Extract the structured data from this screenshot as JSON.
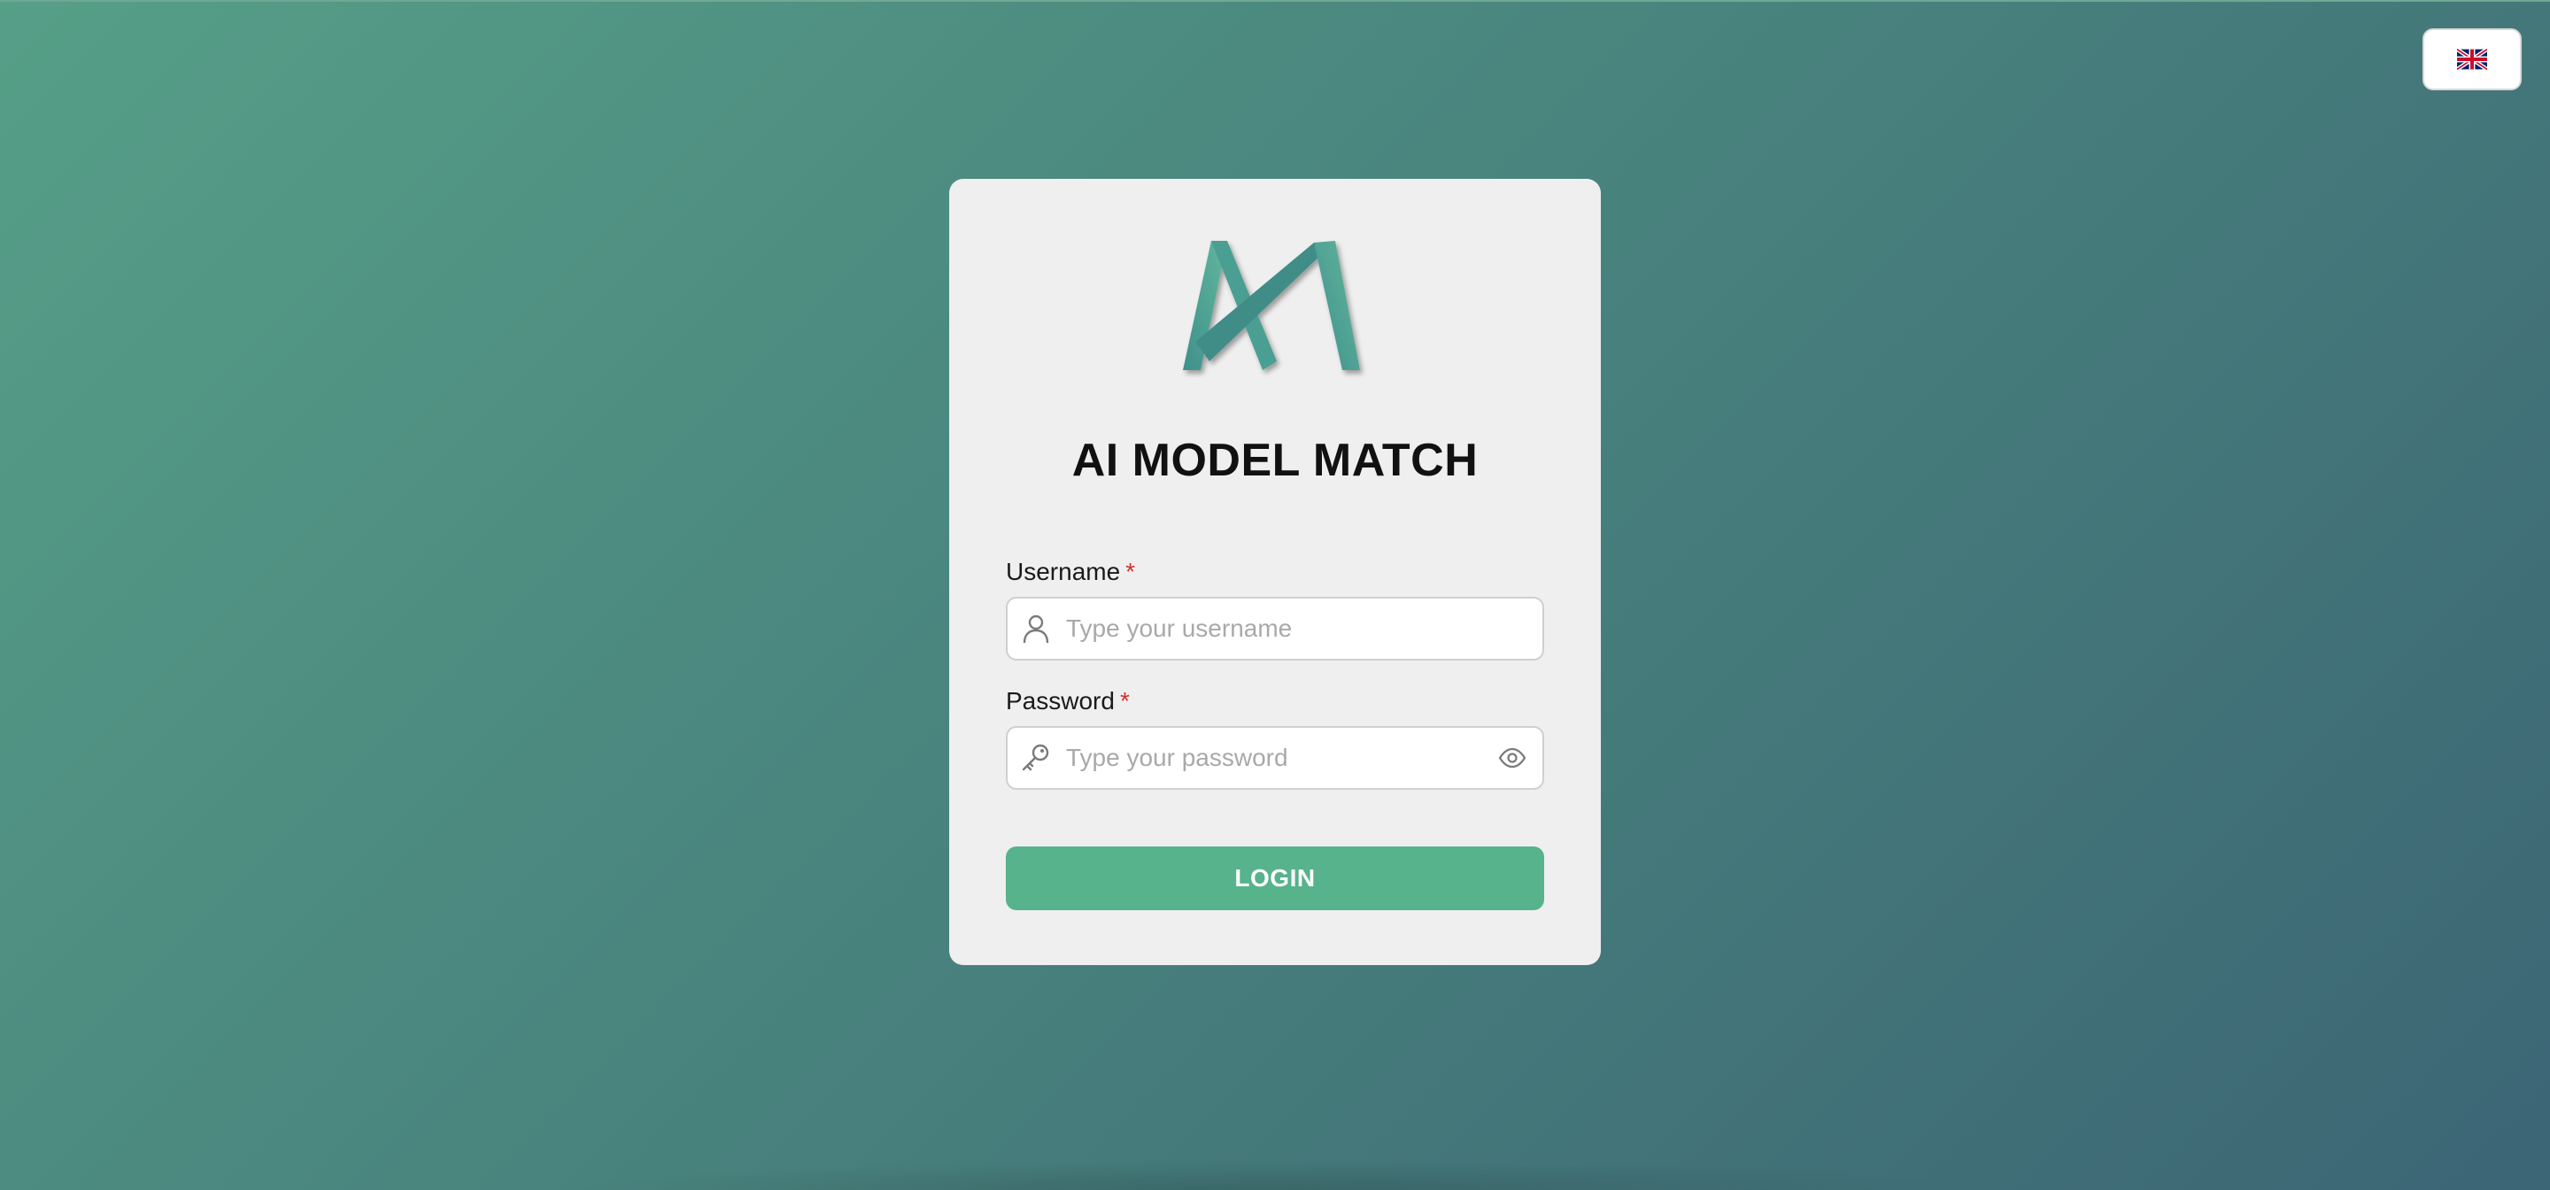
{
  "app": {
    "title": "AI MODEL MATCH"
  },
  "language": {
    "icon": "uk-flag-icon",
    "selected": "English"
  },
  "form": {
    "username_label": "Username",
    "username_required": "*",
    "username_placeholder": "Type your username",
    "username_icon": "user-icon",
    "password_label": "Password",
    "password_required": "*",
    "password_placeholder": "Type your password",
    "password_icon": "key-icon",
    "password_toggle_icon": "eye-icon",
    "login_label": "LOGIN"
  },
  "colors": {
    "accent": "#56b38b",
    "card": "#efefef",
    "required": "#d32f2f"
  }
}
